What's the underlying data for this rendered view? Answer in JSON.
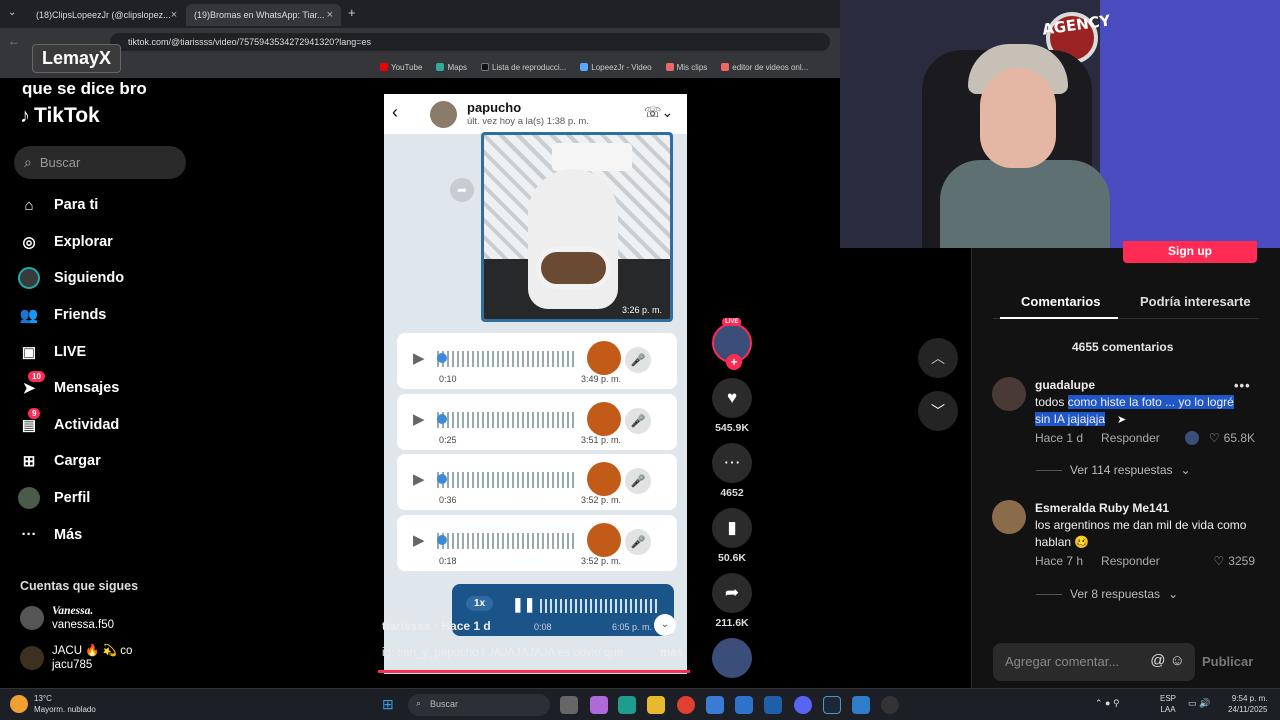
{
  "browser": {
    "tabs": [
      {
        "label": "(18)ClipsLopeezJr (@clipslopez..."
      },
      {
        "label": "(19)Bromas en WhatsApp: Tiar..."
      }
    ],
    "url": "tiktok.com/@tiarissss/video/7575943534272941320?lang=es",
    "bookmarks": [
      "YouTube",
      "Maps",
      "Lista de reproducci...",
      "LopeezJr - Video",
      "Mis clips",
      "editor de videos onl..."
    ]
  },
  "overlay": {
    "streamer_name": "LemayX",
    "caption": "que se dice bro"
  },
  "sidebar": {
    "logo": "TikTok",
    "search_placeholder": "Buscar",
    "nav": [
      {
        "label": "Para ti",
        "icon": "home-icon"
      },
      {
        "label": "Explorar",
        "icon": "compass-icon"
      },
      {
        "label": "Siguiendo",
        "icon": "following-avatar-icon"
      },
      {
        "label": "Friends",
        "icon": "friends-icon"
      },
      {
        "label": "LIVE",
        "icon": "live-icon"
      },
      {
        "label": "Mensajes",
        "icon": "messages-icon",
        "badge": "10"
      },
      {
        "label": "Actividad",
        "icon": "activity-icon",
        "badge": "9"
      },
      {
        "label": "Cargar",
        "icon": "upload-icon"
      },
      {
        "label": "Perfil",
        "icon": "profile-icon"
      },
      {
        "label": "Más",
        "icon": "more-icon"
      }
    ],
    "following_title": "Cuentas que sigues",
    "following": [
      {
        "name": "Vanessa.",
        "handle": "vanessa.f50"
      },
      {
        "name": "JACU 🔥 💫 co",
        "handle": "jacu785"
      }
    ]
  },
  "video": {
    "chat_name": "papucho",
    "chat_status": "últ. vez hoy a la(s) 1:38 p. m.",
    "photo_time": "3:26 p. m.",
    "voice_notes": [
      {
        "duration": "0:10",
        "time": "3:49 p. m."
      },
      {
        "duration": "0:25",
        "time": "3:51 p. m."
      },
      {
        "duration": "0:36",
        "time": "3:52 p. m."
      },
      {
        "duration": "0:18",
        "time": "3:52 p. m."
      }
    ],
    "player": {
      "speed": "1x",
      "elapsed": "0:08",
      "time": "6:05 p. m."
    },
    "author": "tiarissss · Hace 1 d",
    "description": "ig: tiari_y_papucho / JAJAJAJAJA es obvio que",
    "more": "más"
  },
  "actions": {
    "live": "LIVE",
    "likes": "545.9K",
    "comments": "4652",
    "saves": "50.6K",
    "shares": "211.6K"
  },
  "webcam": {
    "watermark": "AGENCY"
  },
  "comments": {
    "signup": "Sign up",
    "tab_comments": "Comentarios",
    "tab_related": "Podría interesarte",
    "count": "4655 comentarios",
    "items": [
      {
        "user": "guadalupe",
        "text_plain": "todos ",
        "text_selected_1": "como histe la foto ... yo lo logré",
        "text_selected_2": "sin IA jajajaja",
        "time": "Hace 1 d",
        "reply": "Responder",
        "likes": "65.8K",
        "replies": "Ver 114 respuestas"
      },
      {
        "user": "Esmeralda Ruby Me141",
        "text": "los argentinos me dan mil de vida como hablan 🥴",
        "time": "Hace 7 h",
        "reply": "Responder",
        "likes": "3259",
        "replies": "Ver 8 respuestas"
      }
    ],
    "input_placeholder": "Agregar comentar...",
    "post": "Publicar"
  },
  "taskbar": {
    "temp": "13°C",
    "weather": "Mayorm. nublado",
    "search": "Buscar",
    "lang1": "ESP",
    "lang2": "LAA",
    "time": "9:54 p. m.",
    "date": "24/11/2025"
  }
}
